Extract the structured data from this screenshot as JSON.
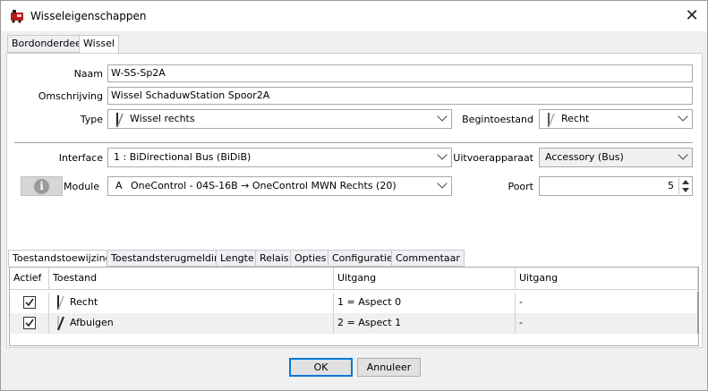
{
  "window": {
    "title": "Wisseleigenschappen"
  },
  "top_tabs": [
    {
      "label": "Bordonderdeel",
      "active": false
    },
    {
      "label": "Wissel",
      "active": true
    }
  ],
  "form": {
    "naam_label": "Naam",
    "naam_value": "W-SS-Sp2A",
    "omschrijving_label": "Omschrijving",
    "omschrijving_value": "Wissel SchaduwStation Spoor2A",
    "type_label": "Type",
    "type_value": "Wissel rechts",
    "begintoestand_label": "Begintoestand",
    "begintoestand_value": "Recht",
    "interface_label": "Interface",
    "interface_value": "1 : BiDirectional Bus (BiDiB)",
    "uitvoerapparaat_label": "Uitvoerapparaat",
    "uitvoerapparaat_value": "Accessory (Bus)",
    "module_label": "Module",
    "module_prefix": "A",
    "module_value": "OneControl - 04S-16B → OneControl MWN Rechts (20)",
    "poort_label": "Poort",
    "poort_value": "5"
  },
  "bottom_tabs": [
    {
      "label": "Toestandstoewijzing",
      "active": true
    },
    {
      "label": "Toestandsterugmelding",
      "active": false
    },
    {
      "label": "Lengte",
      "active": false
    },
    {
      "label": "Relais",
      "active": false
    },
    {
      "label": "Opties",
      "active": false
    },
    {
      "label": "Configuratie",
      "active": false
    },
    {
      "label": "Commentaar",
      "active": false
    }
  ],
  "table": {
    "headers": [
      "Actief",
      "Toestand",
      "Uitgang",
      "Uitgang"
    ],
    "rows": [
      {
        "actief": true,
        "toestand": "Recht",
        "uitgang1": "1 = Aspect 0",
        "uitgang2": "-"
      },
      {
        "actief": true,
        "toestand": "Afbuigen",
        "uitgang1": "2 = Aspect 1",
        "uitgang2": "-"
      }
    ]
  },
  "buttons": {
    "ok": "OK",
    "cancel": "Annuleer"
  },
  "colors": {
    "accent": "#0078d7",
    "row_alt": "#f0f0f0"
  },
  "icons": {
    "app": "railway-app-icon",
    "close": "close-icon",
    "info": "info-icon",
    "turnout": "turnout-icon",
    "check": "check-icon",
    "dropdown": "chevron-down-icon"
  }
}
